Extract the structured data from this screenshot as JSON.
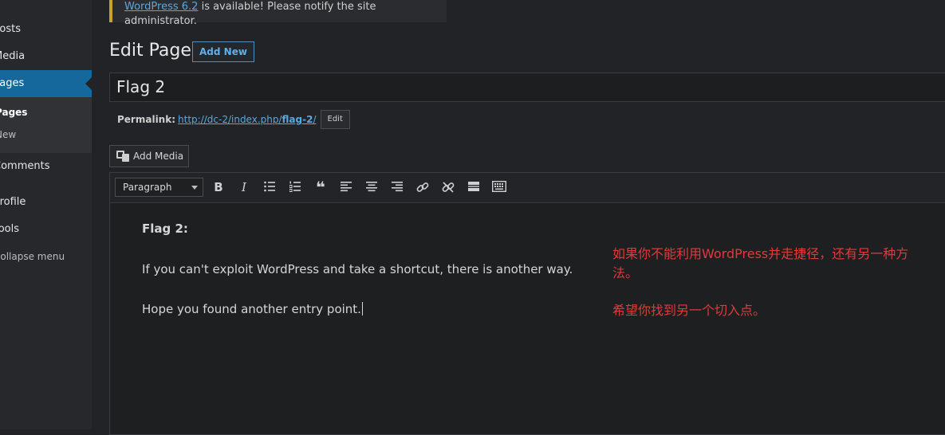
{
  "sidebar": {
    "items": [
      {
        "label": "Posts"
      },
      {
        "label": "Media"
      },
      {
        "label": "Pages"
      },
      {
        "label": "Comments"
      },
      {
        "label": "Profile"
      },
      {
        "label": "Tools"
      },
      {
        "label": "Collapse menu"
      }
    ],
    "submenu": [
      {
        "label": "Pages"
      },
      {
        "label": "New"
      }
    ]
  },
  "notice": {
    "link_text": "WordPress 6.2",
    "text": "is available! Please notify the site administrator."
  },
  "header": {
    "title": "Edit Page",
    "add_new_label": "Add New"
  },
  "post": {
    "title_value": "Flag 2",
    "permalink_label": "Permalink:",
    "permalink_base": "http://dc-2/index.php/",
    "permalink_slug": "flag-2",
    "permalink_trailing": "/",
    "permalink_edit_label": "Edit"
  },
  "media": {
    "add_media_label": "Add Media"
  },
  "toolbar": {
    "format_value": "Paragraph",
    "buttons": [
      {
        "icon": "bold-icon",
        "glyph": "B"
      },
      {
        "icon": "italic-icon",
        "glyph": "I"
      },
      {
        "icon": "bulleted-list-icon"
      },
      {
        "icon": "numbered-list-icon"
      },
      {
        "icon": "blockquote-icon",
        "glyph": "❝"
      },
      {
        "icon": "align-left-icon"
      },
      {
        "icon": "align-center-icon"
      },
      {
        "icon": "align-right-icon"
      },
      {
        "icon": "link-icon"
      },
      {
        "icon": "unlink-icon"
      },
      {
        "icon": "read-more-icon"
      },
      {
        "icon": "toolbar-toggle-icon"
      }
    ]
  },
  "content": {
    "heading": "Flag 2:",
    "paragraph_1": "If you can't exploit WordPress and take a shortcut, there is another way.",
    "paragraph_2": "Hope you found another entry point."
  },
  "annotations": {
    "line_1": "如果你不能利用WordPress并走捷径，还有另一种方法。",
    "line_2": "希望你找到另一个切入点。",
    "color": "#e03a3a"
  },
  "colors": {
    "sidebar_active": "#14689b",
    "link": "#58a9e0",
    "notice_border": "#c9a22c"
  }
}
